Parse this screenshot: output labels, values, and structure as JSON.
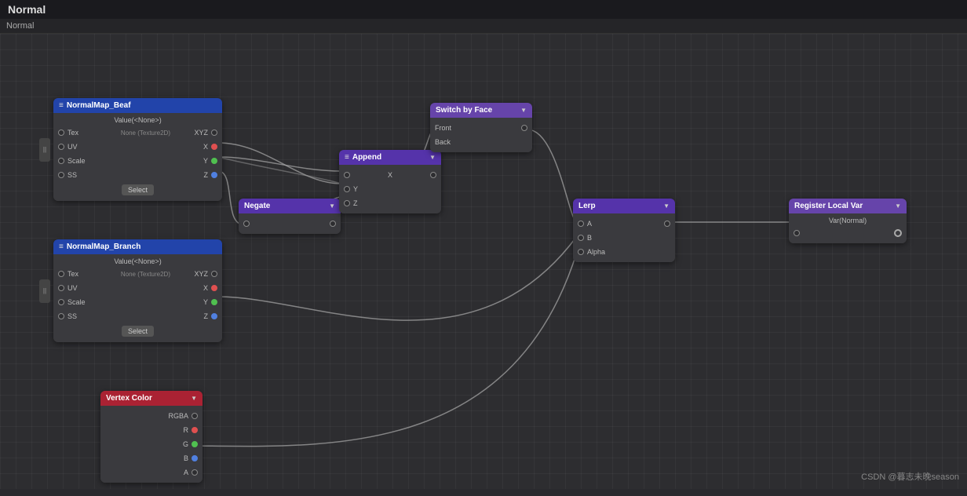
{
  "titleBar": {
    "title": "Normal"
  },
  "tabBar": {
    "activeTab": "Normal"
  },
  "nodes": {
    "normalMapBeaf": {
      "title": "NormalMap_Beaf",
      "subtitle": "Value(<None>)",
      "inputs": [
        {
          "label": "Tex",
          "value": "None (Texture2D)",
          "port": "empty"
        },
        {
          "label": "UV",
          "port": "empty"
        },
        {
          "label": "Scale",
          "port": "empty"
        },
        {
          "label": "SS",
          "port": "empty"
        }
      ],
      "outputs": [
        {
          "label": "XYZ",
          "port": "empty"
        },
        {
          "label": "X",
          "port": "red"
        },
        {
          "label": "Y",
          "port": "green"
        },
        {
          "label": "Z",
          "port": "blue"
        }
      ],
      "selectBtn": "Select"
    },
    "normalMapBranch": {
      "title": "NormalMap_Branch",
      "subtitle": "Value(<None>)",
      "inputs": [
        {
          "label": "Tex",
          "value": "None (Texture2D)",
          "port": "empty"
        },
        {
          "label": "UV",
          "port": "empty"
        },
        {
          "label": "Scale",
          "port": "empty"
        },
        {
          "label": "SS",
          "port": "empty"
        }
      ],
      "outputs": [
        {
          "label": "XYZ",
          "port": "empty"
        },
        {
          "label": "X",
          "port": "red"
        },
        {
          "label": "Y",
          "port": "green"
        },
        {
          "label": "Z",
          "port": "blue"
        }
      ],
      "selectBtn": "Select"
    },
    "negate": {
      "title": "Negate",
      "inputs": [
        {
          "label": "",
          "port": "empty"
        }
      ],
      "outputs": [
        {
          "label": "",
          "port": "empty"
        }
      ]
    },
    "append": {
      "title": "Append",
      "inputs": [
        {
          "label": "X",
          "port": "empty"
        },
        {
          "label": "Y",
          "port": "empty"
        },
        {
          "label": "Z",
          "port": "empty"
        }
      ],
      "outputs": [
        {
          "label": "",
          "port": "empty"
        }
      ]
    },
    "switchByFace": {
      "title": "Switch by Face",
      "inputs": [
        {
          "label": "Front",
          "port": "empty"
        },
        {
          "label": "Back",
          "port": "empty"
        }
      ],
      "outputs": [
        {
          "label": "",
          "port": "empty"
        }
      ]
    },
    "lerp": {
      "title": "Lerp",
      "inputs": [
        {
          "label": "A",
          "port": "empty"
        },
        {
          "label": "B",
          "port": "empty"
        },
        {
          "label": "Alpha",
          "port": "empty"
        }
      ],
      "outputs": [
        {
          "label": "",
          "port": "empty"
        }
      ]
    },
    "registerLocalVar": {
      "title": "Register Local Var",
      "subtitle": "Var(Normal)",
      "inputs": [
        {
          "label": "",
          "port": "empty"
        }
      ],
      "outputs": [
        {
          "label": "",
          "port": "circle"
        }
      ]
    },
    "vertexColor": {
      "title": "Vertex Color",
      "outputs": [
        {
          "label": "RGBA",
          "port": "empty"
        },
        {
          "label": "R",
          "port": "red"
        },
        {
          "label": "G",
          "port": "green"
        },
        {
          "label": "B",
          "port": "blue"
        },
        {
          "label": "A",
          "port": "empty"
        }
      ]
    }
  },
  "watermark": "CSDN @暮志未晚season"
}
